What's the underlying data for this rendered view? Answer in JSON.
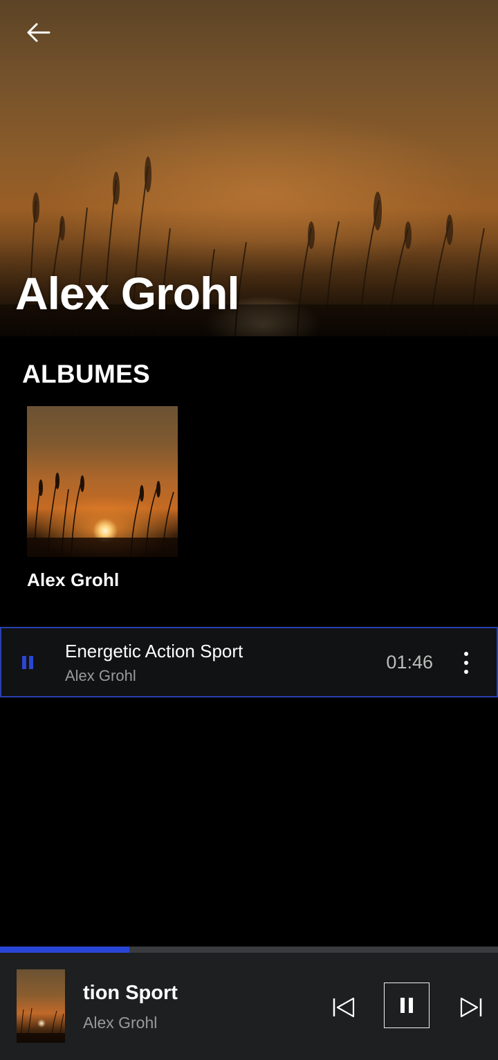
{
  "header": {
    "back_icon": "arrow-left-icon",
    "artist_name": "Alex Grohl"
  },
  "albums": {
    "section_title": "ALBUMES",
    "items": [
      {
        "name": "Alex Grohl",
        "cover": "sunset-grass-image"
      }
    ]
  },
  "tracks": [
    {
      "title": "Energetic Action Sport",
      "artist": "Alex Grohl",
      "duration": "01:46",
      "state": "playing",
      "state_icon": "pause-icon",
      "menu_icon": "more-vertical-icon"
    }
  ],
  "player": {
    "visible_title": "tion Sport",
    "artist": "Alex Grohl",
    "progress_fraction": 0.26,
    "controls": [
      "skip-previous-icon",
      "pause-icon",
      "skip-next-icon"
    ]
  },
  "colors": {
    "accent": "#2a46d6",
    "background": "#000000",
    "player_background": "#1d1f20",
    "secondary_text": "#9a9a9a"
  }
}
